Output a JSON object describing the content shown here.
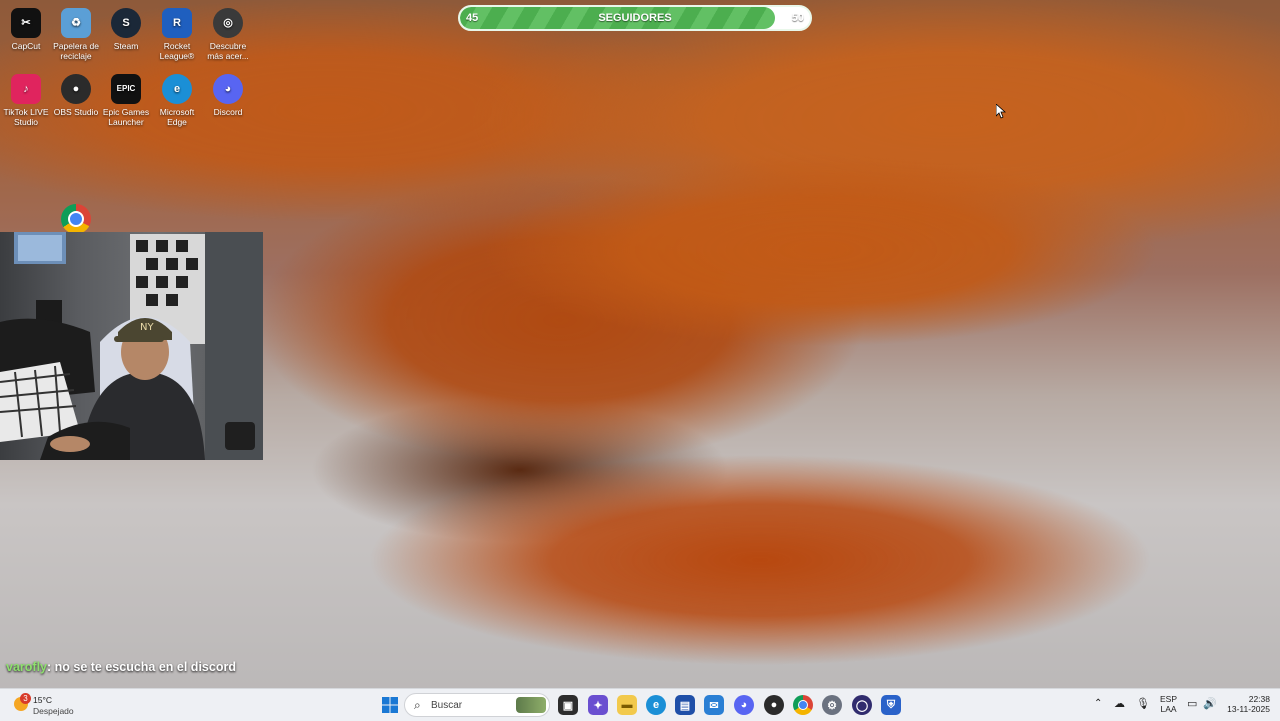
{
  "desktop_icons": [
    {
      "label": "CapCut",
      "glyph": "✂",
      "color": "#111111",
      "icon": "capcut-icon"
    },
    {
      "label": "Papelera de reciclaje",
      "glyph": "♻",
      "color": "#5b9fd6",
      "icon": "recycle-bin-icon"
    },
    {
      "label": "Steam",
      "glyph": "S",
      "color": "#1b2838",
      "icon": "steam-icon"
    },
    {
      "label": "Rocket League®",
      "glyph": "R",
      "color": "#1f5fbf",
      "icon": "rocket-league-icon"
    },
    {
      "label": "Descubre más acer...",
      "glyph": "◎",
      "color": "#3a3a3a",
      "icon": "acer-icon"
    },
    {
      "label": "TikTok LIVE Studio",
      "glyph": "♪",
      "color": "#e0245e",
      "icon": "tiktok-icon"
    },
    {
      "label": "OBS Studio",
      "glyph": "●",
      "color": "#2b2b2b",
      "icon": "obs-icon"
    },
    {
      "label": "Epic Games Launcher",
      "glyph": "EPIC",
      "color": "#111111",
      "icon": "epic-games-icon"
    },
    {
      "label": "Microsoft Edge",
      "glyph": "e",
      "color": "#1b8fd6",
      "icon": "edge-icon"
    },
    {
      "label": "Discord",
      "glyph": "◕",
      "color": "#5865f2",
      "icon": "discord-icon"
    },
    {
      "label": "",
      "glyph": "◉",
      "color": "#db4437",
      "icon": "chrome-icon"
    }
  ],
  "progress": {
    "start": "45",
    "label": "SEGUIDORES",
    "end": "50",
    "fraction": 0.9
  },
  "chat": {
    "user": "varofly",
    "message": ": no se te escucha en el discord"
  },
  "weather": {
    "badge": "3",
    "temp": "15°C",
    "desc": "Despejado"
  },
  "taskbar": {
    "search_placeholder": "Buscar"
  },
  "tray": {
    "lang_top": "ESP",
    "lang_bottom": "LAA",
    "time": "22:38",
    "date": "13-11-2025"
  },
  "colors": {
    "progress_fill": "#4cae4f",
    "chat_user": "#8ee06e",
    "taskbar_bg": "#eef0f4"
  }
}
